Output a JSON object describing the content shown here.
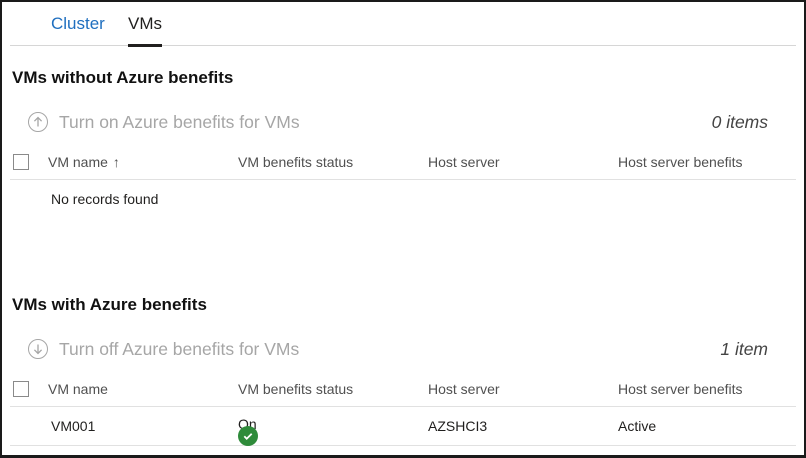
{
  "tabs": [
    {
      "label": "Cluster",
      "selected": false
    },
    {
      "label": "VMs",
      "selected": true
    }
  ],
  "section_without": {
    "title": "VMs without Azure benefits",
    "command": {
      "label": "Turn on Azure benefits for VMs",
      "icon": "arrow-up-circle-icon",
      "enabled": false
    },
    "count": "0 items",
    "columns": [
      "VM name",
      "VM benefits status",
      "Host server",
      "Host server benefits"
    ],
    "sort_column": "VM name",
    "empty_message": "No records found"
  },
  "section_with": {
    "title": "VMs with Azure benefits",
    "command": {
      "label": "Turn off Azure benefits for VMs",
      "icon": "arrow-down-circle-icon",
      "enabled": false
    },
    "count": "1 item",
    "columns": [
      "VM name",
      "VM benefits status",
      "Host server",
      "Host server benefits"
    ],
    "rows": [
      {
        "vm_name": "VM001",
        "status": "On",
        "host_server": "AZSHCI3",
        "host_benefits": "Active"
      }
    ]
  },
  "colors": {
    "link": "#1f6fbf",
    "success": "#2e8b3a",
    "disabled": "#a6a6a6"
  }
}
